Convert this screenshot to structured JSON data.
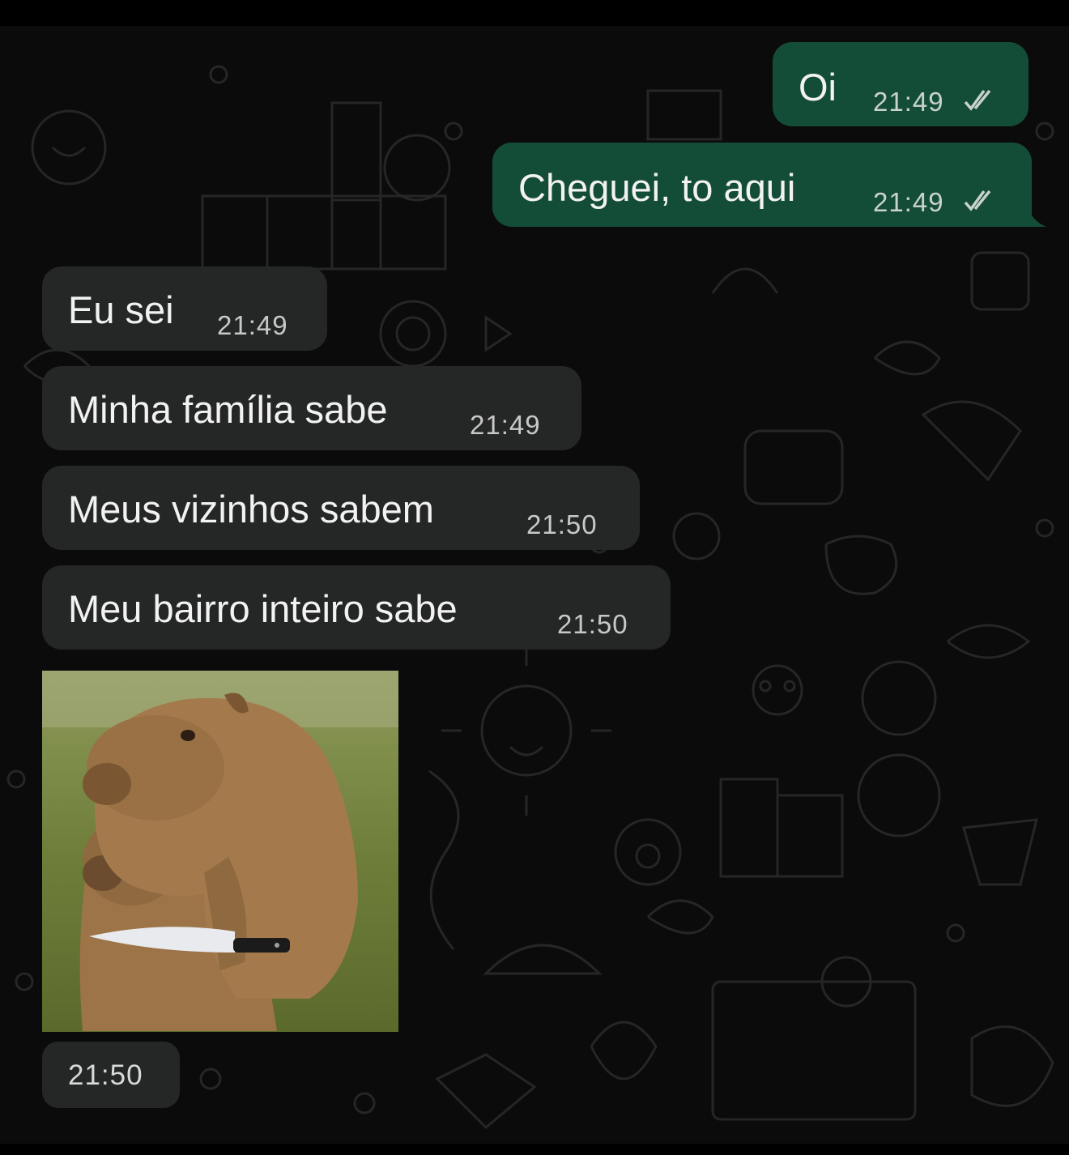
{
  "messages": [
    {
      "direction": "outgoing",
      "text": "Oi",
      "time": "21:49",
      "status": "read-double-check"
    },
    {
      "direction": "outgoing",
      "text": "Cheguei, to aqui",
      "time": "21:49",
      "status": "read-double-check"
    },
    {
      "direction": "incoming",
      "text": "Eu sei",
      "time": "21:49"
    },
    {
      "direction": "incoming",
      "text": "Minha família sabe",
      "time": "21:49"
    },
    {
      "direction": "incoming",
      "text": "Meus vizinhos sabem",
      "time": "21:50"
    },
    {
      "direction": "incoming",
      "text": "Meu bairro inteiro sabe",
      "time": "21:50"
    }
  ],
  "image_message": {
    "image": "photo of two capybaras, the top one holding a knife",
    "time": "21:50"
  },
  "colors": {
    "outgoing_bubble": "#144d37",
    "incoming_bubble": "#252626",
    "wallpaper": "#0b0b0b",
    "text": "#f2f2f2"
  },
  "icons": [
    "double-check-icon"
  ]
}
